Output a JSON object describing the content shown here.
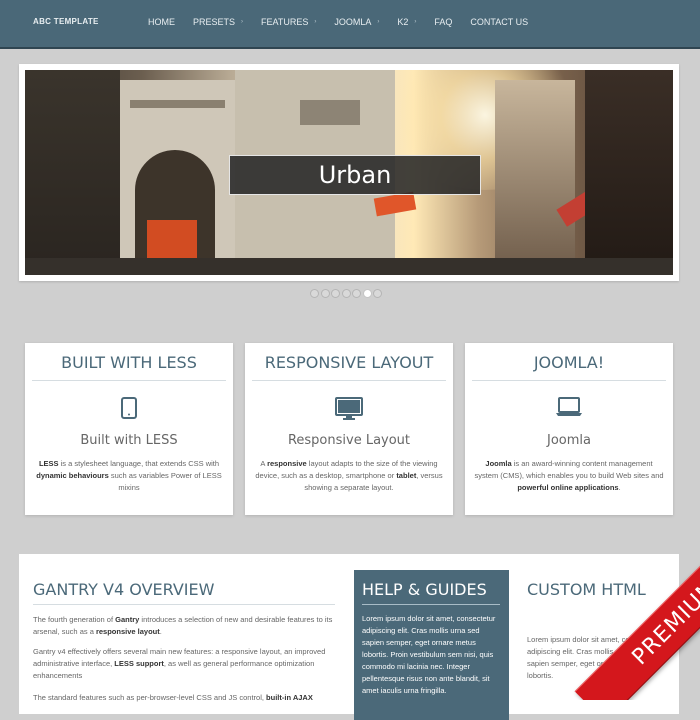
{
  "header": {
    "logo": "ABC TEMPLATE",
    "nav": [
      {
        "label": "HOME",
        "has_submenu": false
      },
      {
        "label": "PRESETS",
        "has_submenu": true
      },
      {
        "label": "FEATURES",
        "has_submenu": true
      },
      {
        "label": "JOOMLA",
        "has_submenu": true
      },
      {
        "label": "K2",
        "has_submenu": true
      },
      {
        "label": "FAQ",
        "has_submenu": false
      },
      {
        "label": "CONTACT US",
        "has_submenu": false
      }
    ],
    "submenu_caret": "›"
  },
  "slideshow": {
    "caption": "Urban",
    "slide_count": 7,
    "active_slide": 6
  },
  "features": [
    {
      "title": "BUILT WITH LESS",
      "icon": "tablet-icon",
      "subtitle": "Built with LESS",
      "text_parts": [
        {
          "text": "LESS",
          "bold": true
        },
        {
          "text": " is a stylesheet language, that extends CSS with ",
          "bold": false
        },
        {
          "text": "dynamic behaviours",
          "bold": true
        },
        {
          "text": " such as variables Power of LESS mixins",
          "bold": false
        }
      ]
    },
    {
      "title": "RESPONSIVE LAYOUT",
      "icon": "desktop-icon",
      "subtitle": "Responsive Layout",
      "text_parts": [
        {
          "text": "A ",
          "bold": false
        },
        {
          "text": "responsive",
          "bold": true
        },
        {
          "text": " layout adapts to the size of the viewing device, such as a desktop, smartphone or ",
          "bold": false
        },
        {
          "text": "tablet",
          "bold": true
        },
        {
          "text": ", versus showing a separate layout.",
          "bold": false
        }
      ]
    },
    {
      "title": "JOOMLA!",
      "icon": "laptop-icon",
      "subtitle": "Joomla",
      "text_parts": [
        {
          "text": "Joomla",
          "bold": true
        },
        {
          "text": " is an award-winning content management system (CMS), which enables you to build Web sites and ",
          "bold": false
        },
        {
          "text": "powerful online applications",
          "bold": true
        },
        {
          "text": ".",
          "bold": false
        }
      ]
    }
  ],
  "overview": {
    "title": "GANTRY V4 OVERVIEW",
    "paragraphs": [
      [
        {
          "text": "The fourth generation of ",
          "bold": false
        },
        {
          "text": "Gantry",
          "bold": true
        },
        {
          "text": " introduces a selection of new and desirable features to its arsenal, such as a ",
          "bold": false
        },
        {
          "text": "responsive layout",
          "bold": true
        },
        {
          "text": ".",
          "bold": false
        }
      ],
      [
        {
          "text": "Gantry v4 effectively offers several main new features: a responsive layout, an improved administrative interface, ",
          "bold": false
        },
        {
          "text": "LESS support",
          "bold": true
        },
        {
          "text": ", as well as general performance optimization enhancements",
          "bold": false
        }
      ],
      [
        {
          "text": "The standard features such as per-browser-level CSS and JS control, ",
          "bold": false
        },
        {
          "text": "built-in AJAX",
          "bold": true
        }
      ]
    ]
  },
  "help": {
    "title": "HELP & GUIDES",
    "text": "Lorem ipsum dolor sit amet, consectetur adipiscing elit. Cras mollis urna sed sapien semper, eget ornare metus lobortis. Proin vestibulum sem nisi, quis commodo mi lacinia nec. Integer pellentesque risus non ante blandit, sit amet iaculis urna fringilla."
  },
  "custom": {
    "title": "CUSTOM HTML",
    "text": "Lorem ipsum dolor sit amet, consectetur adipiscing elit. Cras mollis urna sed sapien semper, eget ornare metus lobortis."
  },
  "ribbon": {
    "label": "PREMIUM"
  },
  "colors": {
    "header_bg": "#4a6878",
    "accent": "#4b6979",
    "ribbon": "#d4171c",
    "page_bg": "#cfcfcf"
  }
}
